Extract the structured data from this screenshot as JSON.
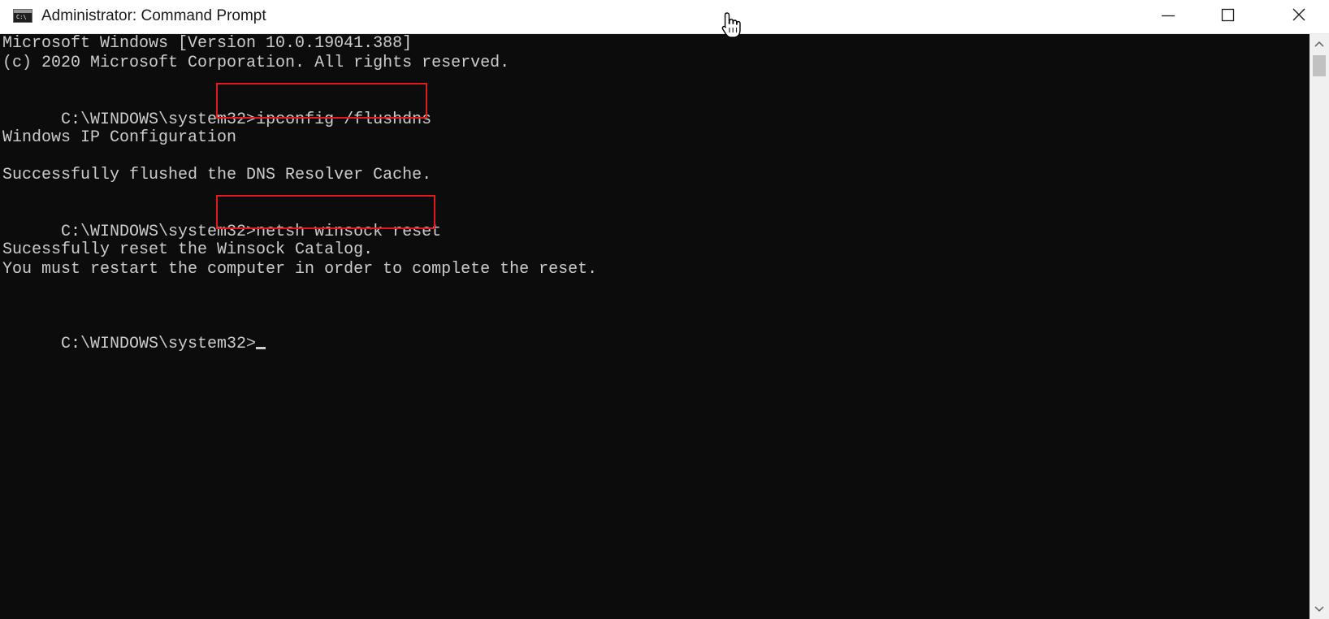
{
  "window": {
    "title": "Administrator: Command Prompt",
    "icon_glyph": "C:\\",
    "controls": {
      "minimize": "minimize-icon",
      "maximize": "maximize-icon",
      "close": "close-icon"
    }
  },
  "console": {
    "lines": [
      "Microsoft Windows [Version 10.0.19041.388]",
      "(c) 2020 Microsoft Corporation. All rights reserved.",
      "Windows IP Configuration",
      "Successfully flushed the DNS Resolver Cache.",
      "Sucessfully reset the Winsock Catalog.",
      "You must restart the computer in order to complete the reset."
    ],
    "prompt": "C:\\WINDOWS\\system32>",
    "commands": [
      "ipconfig /flushdns",
      "netsh winsock reset"
    ]
  },
  "colors": {
    "console_background": "#0c0c0c",
    "console_text": "#cccccc",
    "highlight_border": "#e01b1b",
    "titlebar_background": "#ffffff"
  },
  "icons": {
    "app": "command-prompt-icon",
    "pointer": "hand-pointer-icon",
    "scroll_up": "scroll-up-arrow-icon",
    "scroll_down": "scroll-down-arrow-icon"
  }
}
